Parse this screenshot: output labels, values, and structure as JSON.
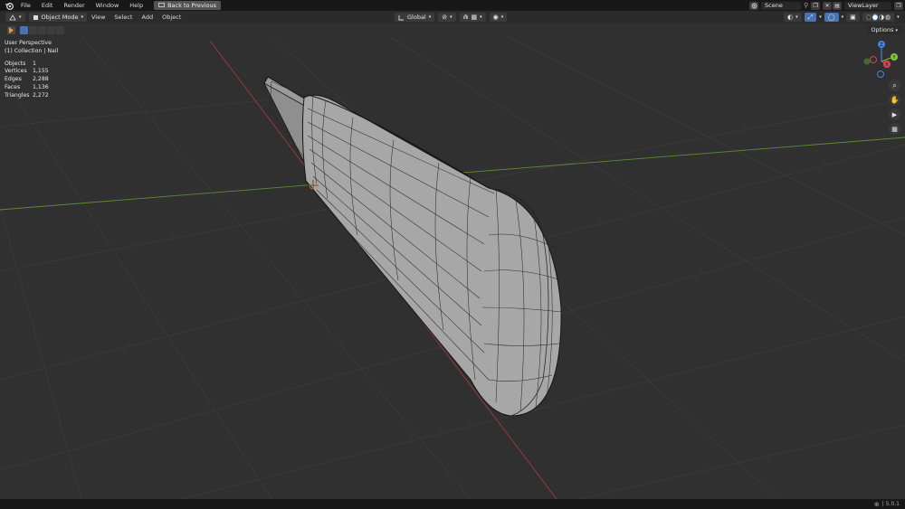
{
  "topbar": {
    "menus": [
      "File",
      "Edit",
      "Render",
      "Window",
      "Help"
    ],
    "back_button": "Back to Previous",
    "scene": "Scene",
    "view_layer": "ViewLayer"
  },
  "header": {
    "mode": "Object Mode",
    "menus": [
      "View",
      "Select",
      "Add",
      "Object"
    ],
    "transform_orientation": "Global"
  },
  "toolrow": {
    "options": "Options"
  },
  "overlay": {
    "perspective": "User Perspective",
    "collection": "(1) Collection | Nail",
    "stats": [
      {
        "label": "Objects",
        "value": "1"
      },
      {
        "label": "Vertices",
        "value": "1,155"
      },
      {
        "label": "Edges",
        "value": "2,288"
      },
      {
        "label": "Faces",
        "value": "1,136"
      },
      {
        "label": "Triangles",
        "value": "2,272"
      }
    ]
  },
  "gizmo": {
    "z": "Z",
    "y": "Y",
    "x": "X"
  },
  "status": {
    "version": "5.0.1"
  },
  "colors": {
    "x_axis": "#d9425a",
    "y_axis": "#80c23e",
    "z_axis": "#3d87e0",
    "viewport_bg": "#303030",
    "mesh_fill": "#a9a9a9",
    "wire": "#1a1a1a"
  }
}
